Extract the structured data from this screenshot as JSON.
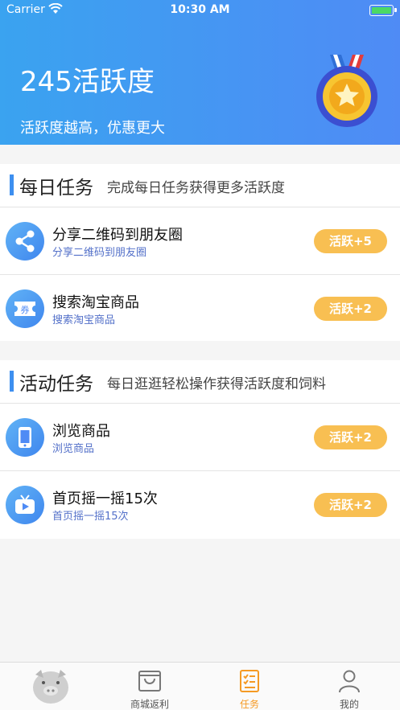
{
  "status_bar": {
    "carrier": "Carrier",
    "time": "10:30 AM"
  },
  "header": {
    "title": "245活跃度",
    "subtitle": "活跃度越高，优惠更大",
    "medal_icon": "medal-icon"
  },
  "daily": {
    "title": "每日任务",
    "description": "完成每日任务获得更多活跃度",
    "tasks": [
      {
        "name": "分享二维码到朋友圈",
        "subtitle": "分享二维码到朋友圈",
        "reward": "活跃+5",
        "icon": "share-icon"
      },
      {
        "name": "搜索淘宝商品",
        "subtitle": "搜索淘宝商品",
        "reward": "活跃+2",
        "icon": "coupon-icon"
      }
    ]
  },
  "activity": {
    "title": "活动任务",
    "description": "每日逛逛轻松操作获得活跃度和饲料",
    "tasks": [
      {
        "name": "浏览商品",
        "subtitle": "浏览商品",
        "reward": "活跃+2",
        "icon": "phone-icon"
      },
      {
        "name": "首页摇一摇15次",
        "subtitle": "首页摇一摇15次",
        "reward": "活跃+2",
        "icon": "tv-icon"
      }
    ]
  },
  "tabbar": {
    "tabs": [
      {
        "label": "",
        "icon": "pig-mascot-icon"
      },
      {
        "label": "商城返利",
        "icon": "bag-icon"
      },
      {
        "label": "任务",
        "icon": "checklist-icon",
        "active": true
      },
      {
        "label": "我的",
        "icon": "user-icon"
      }
    ]
  },
  "colors": {
    "accent": "#3d8ff0",
    "reward_button": "#f8bf52",
    "active_tab": "#f59a23"
  }
}
